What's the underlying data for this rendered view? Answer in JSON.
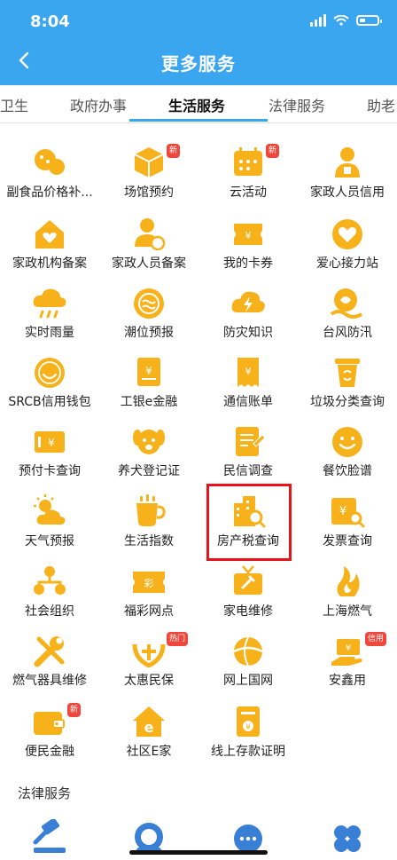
{
  "status": {
    "time": "8:04"
  },
  "header": {
    "title": "更多服务"
  },
  "tabs": [
    {
      "label": "卫生",
      "active": false
    },
    {
      "label": "政府办事",
      "active": false
    },
    {
      "label": "生活服务",
      "active": true
    },
    {
      "label": "法律服务",
      "active": false
    },
    {
      "label": "助老",
      "active": false
    }
  ],
  "services": [
    {
      "label": "副食品价格补...",
      "icon": "food-price-icon"
    },
    {
      "label": "场馆预约",
      "icon": "venue-icon",
      "badge": "新"
    },
    {
      "label": "云活动",
      "icon": "calendar-icon",
      "badge": "新"
    },
    {
      "label": "家政人员信用",
      "icon": "housekeeper-icon"
    },
    {
      "label": "家政机构备案",
      "icon": "house-heart-icon"
    },
    {
      "label": "家政人员备案",
      "icon": "person-record-icon"
    },
    {
      "label": "我的卡券",
      "icon": "coupon-icon"
    },
    {
      "label": "爱心接力站",
      "icon": "heart-icon"
    },
    {
      "label": "实时雨量",
      "icon": "rain-cloud-icon"
    },
    {
      "label": "潮位预报",
      "icon": "tide-icon"
    },
    {
      "label": "防灾知识",
      "icon": "lightning-cloud-icon"
    },
    {
      "label": "台风防汛",
      "icon": "typhoon-icon"
    },
    {
      "label": "SRCB信用钱包",
      "icon": "smile-wallet-icon"
    },
    {
      "label": "工银e金融",
      "icon": "bank-card-icon"
    },
    {
      "label": "通信账单",
      "icon": "bill-icon"
    },
    {
      "label": "垃圾分类查询",
      "icon": "trash-bin-icon"
    },
    {
      "label": "预付卡查询",
      "icon": "prepaid-card-icon"
    },
    {
      "label": "养犬登记证",
      "icon": "dog-icon"
    },
    {
      "label": "民信调查",
      "icon": "survey-icon"
    },
    {
      "label": "餐饮脸谱",
      "icon": "smiley-face-icon"
    },
    {
      "label": "天气预报",
      "icon": "weather-icon"
    },
    {
      "label": "生活指数",
      "icon": "cup-icon"
    },
    {
      "label": "房产税查询",
      "icon": "building-search-icon"
    },
    {
      "label": "发票查询",
      "icon": "invoice-search-icon"
    },
    {
      "label": "社会组织",
      "icon": "organization-icon"
    },
    {
      "label": "福彩网点",
      "icon": "lottery-icon"
    },
    {
      "label": "家电维修",
      "icon": "tv-repair-icon"
    },
    {
      "label": "上海燃气",
      "icon": "gas-flame-icon"
    },
    {
      "label": "燃气器具维修",
      "icon": "wrench-icon"
    },
    {
      "label": "太惠民保",
      "icon": "insurance-icon",
      "badge": "热门"
    },
    {
      "label": "网上国网",
      "icon": "power-grid-icon"
    },
    {
      "label": "安鑫用",
      "icon": "credit-hand-icon",
      "badge": "信用"
    },
    {
      "label": "便民金融",
      "icon": "wallet-icon",
      "badge": "新"
    },
    {
      "label": "社区E家",
      "icon": "community-home-icon"
    },
    {
      "label": "线上存款证明",
      "icon": "deposit-proof-icon"
    }
  ],
  "legal": {
    "title": "法律服务",
    "icons": [
      "gavel-icon",
      "lawyer-icon",
      "consult-icon",
      "clover-icon"
    ]
  },
  "colors": {
    "accent": "#3aa6f0",
    "icon": "#f7b21b",
    "highlight": "#e8121b",
    "badge": "#f0463c"
  }
}
